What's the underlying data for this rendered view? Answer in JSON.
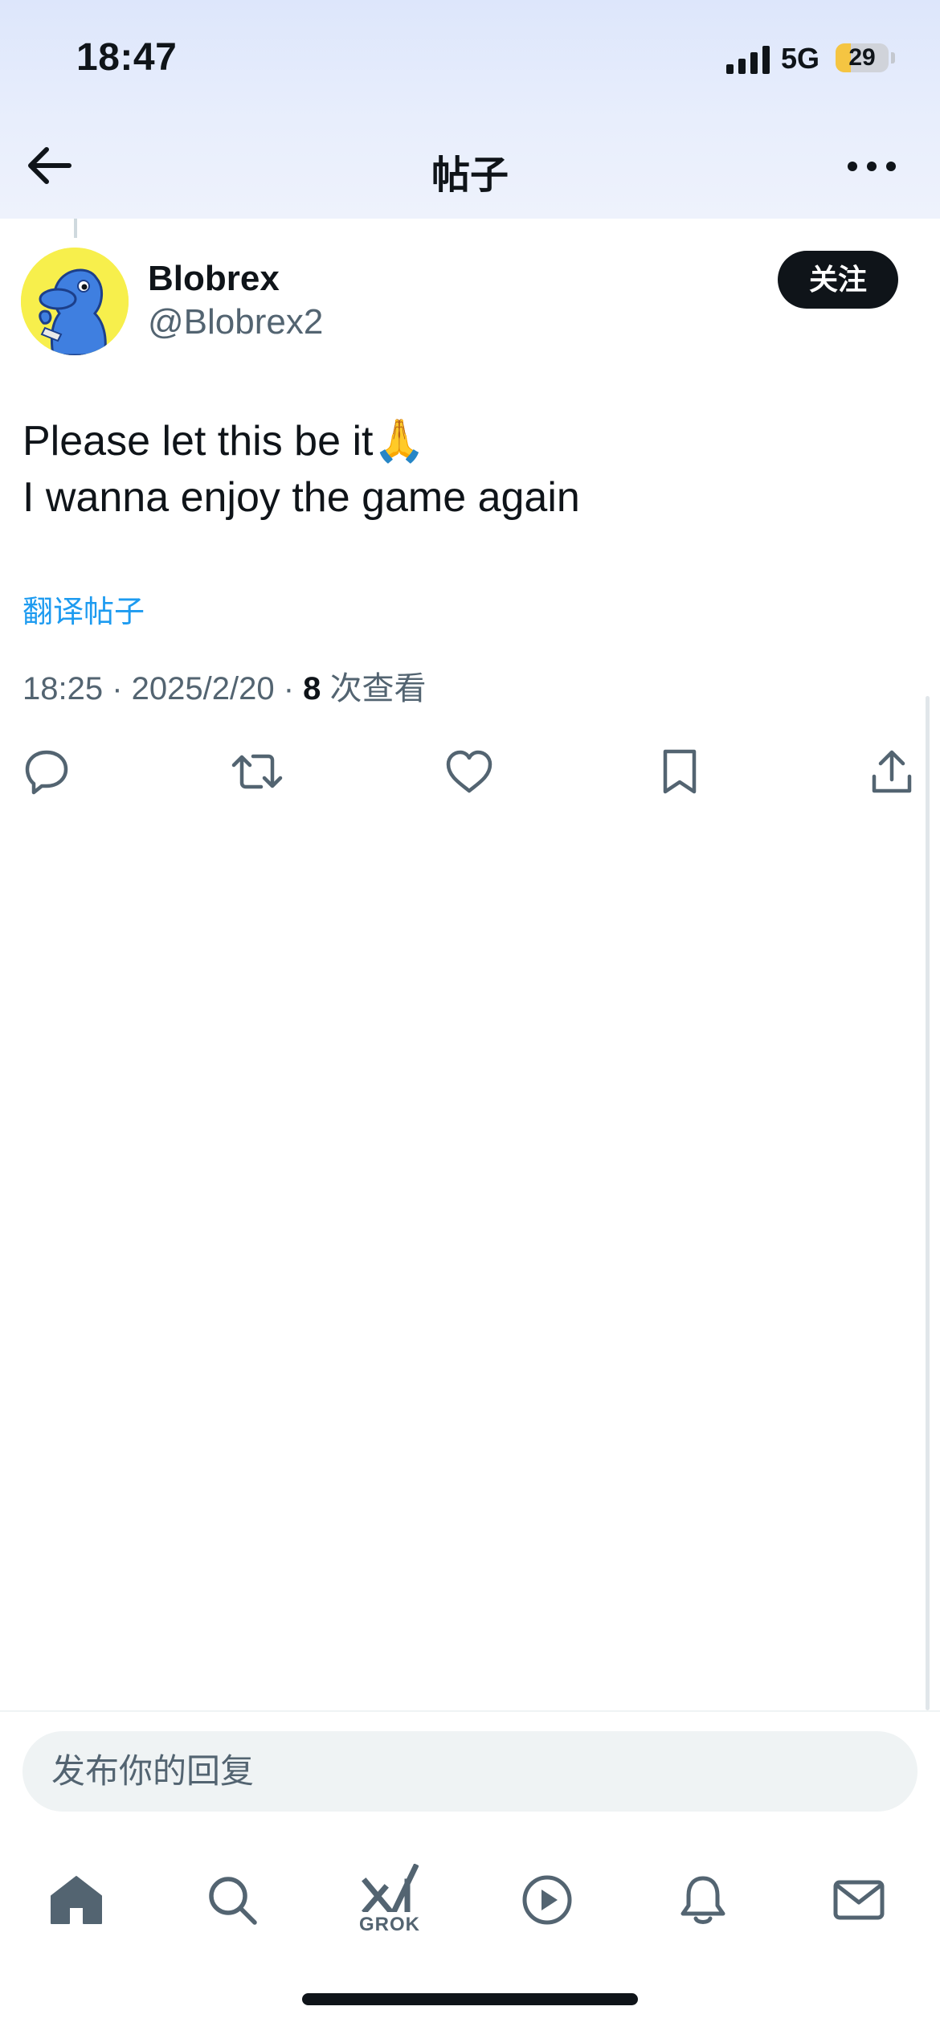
{
  "status_bar": {
    "time": "18:47",
    "network": "5G",
    "battery": "29",
    "battery_level_percent": 29
  },
  "header": {
    "title": "帖子",
    "back_icon": "arrow-left-icon",
    "more_icon": "more-horizontal-icon"
  },
  "post": {
    "author_name": "Blobrex",
    "author_handle": "@Blobrex2",
    "follow_label": "关注",
    "text_lines": [
      "Please let this be it🙏",
      "I wanna enjoy the game again"
    ],
    "translate_label": "翻译帖子",
    "timestamp": "18:25 · 2025/2/20 · ",
    "views_count": "8",
    "views_label": " 次查看",
    "actions": {
      "reply_icon": "reply-bubble-icon",
      "repost_icon": "repost-icon",
      "like_icon": "heart-icon",
      "bookmark_icon": "bookmark-icon",
      "share_icon": "share-icon"
    }
  },
  "reply_box": {
    "placeholder": "发布你的回复"
  },
  "bottom_nav": {
    "items": [
      {
        "icon": "home-icon"
      },
      {
        "icon": "search-icon"
      },
      {
        "icon": "grok-icon",
        "label": "GROK"
      },
      {
        "icon": "play-icon"
      },
      {
        "icon": "bell-icon"
      },
      {
        "icon": "mail-icon"
      }
    ]
  },
  "colors": {
    "accent": "#1d9bf0",
    "text": "#0f1419",
    "muted": "#536471",
    "battery": "#f5c542"
  }
}
